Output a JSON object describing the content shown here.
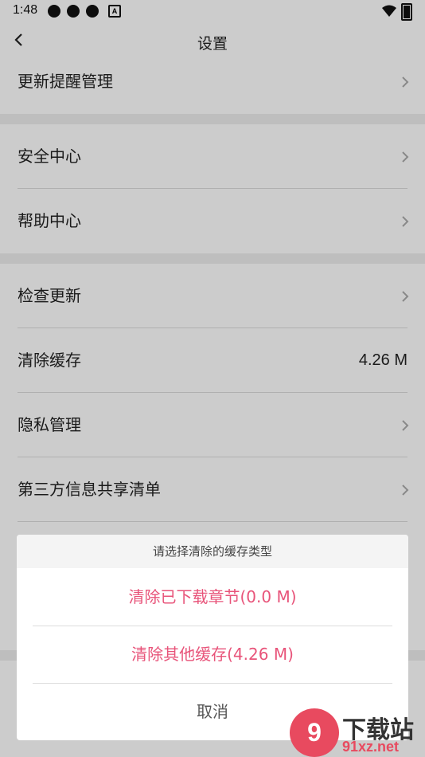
{
  "status_bar": {
    "time": "1:48"
  },
  "header": {
    "title": "设置"
  },
  "settings": {
    "update_reminder": "更新提醒管理",
    "security_center": "安全中心",
    "help_center": "帮助中心",
    "check_update": "检查更新",
    "clear_cache": "清除缓存",
    "clear_cache_value": "4.26 M",
    "privacy_management": "隐私管理",
    "third_party_list": "第三方信息共享清单"
  },
  "dialog": {
    "title": "请选择清除的缓存类型",
    "option_downloaded": "清除已下载章节(0.0 M)",
    "option_other": "清除其他缓存(4.26 M)",
    "cancel": "取消"
  },
  "watermark": {
    "badge": "9",
    "text": "下载站",
    "domain": "91xz.net"
  },
  "colors": {
    "accent": "#e8547a",
    "overlay": "rgba(0,0,0,0.2)"
  }
}
